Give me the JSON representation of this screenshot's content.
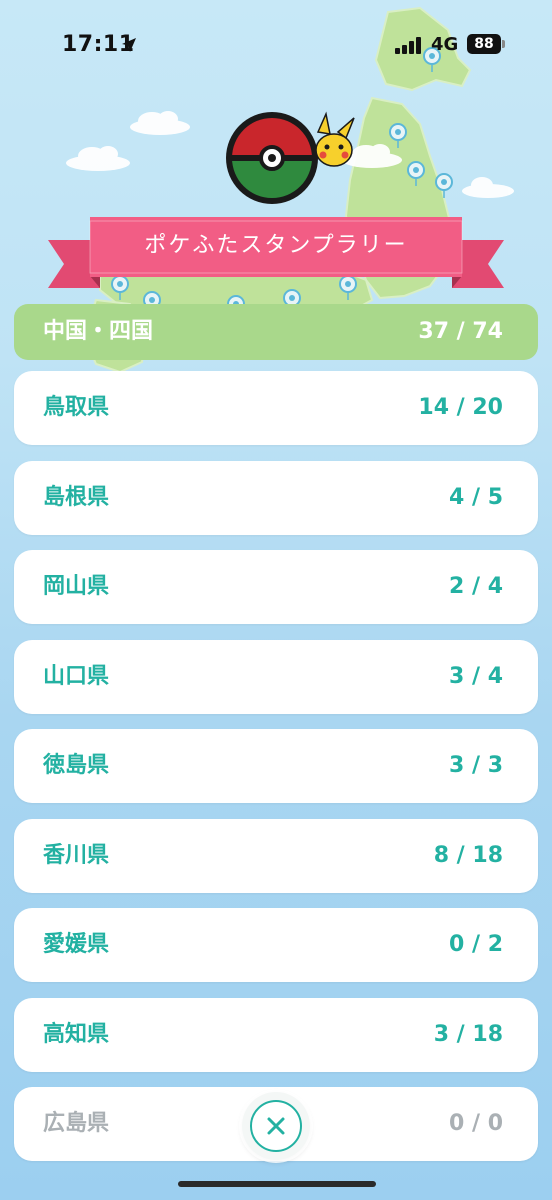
{
  "status_bar": {
    "time": "17:11",
    "network": "4G",
    "battery": "88"
  },
  "header": {
    "title": "ポケふたスタンプラリー"
  },
  "region": {
    "name": "中国・四国",
    "count": "37 / 74"
  },
  "prefectures": [
    {
      "name": "鳥取県",
      "count": "14 / 20"
    },
    {
      "name": "島根県",
      "count": "4 / 5"
    },
    {
      "name": "岡山県",
      "count": "2 / 4"
    },
    {
      "name": "山口県",
      "count": "3 / 4"
    },
    {
      "name": "徳島県",
      "count": "3 / 3"
    },
    {
      "name": "香川県",
      "count": "8 / 18"
    },
    {
      "name": "愛媛県",
      "count": "0 / 2"
    },
    {
      "name": "高知県",
      "count": "3 / 18"
    },
    {
      "name": "広島県",
      "count": "0 / 0"
    }
  ],
  "colors": {
    "accent": "#23b1a2",
    "region_bar": "#a9d88b",
    "ribbon": "#f25d85",
    "disabled": "#aab0b4"
  },
  "icons": {
    "close": "close-icon",
    "location": "location-arrow-icon"
  }
}
